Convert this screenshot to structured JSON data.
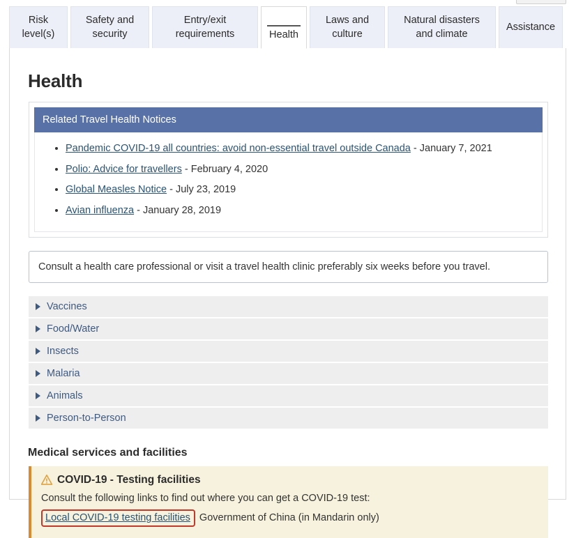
{
  "tabs": [
    {
      "label": "Risk level(s)",
      "active": false
    },
    {
      "label": "Safety and security",
      "active": false
    },
    {
      "label": "Entry/exit requirements",
      "active": false
    },
    {
      "label": "Health",
      "active": true
    },
    {
      "label": "Laws and culture",
      "active": false
    },
    {
      "label": "Natural disasters and climate",
      "active": false
    },
    {
      "label": "Assistance",
      "active": false
    }
  ],
  "page": {
    "title": "Health"
  },
  "notices": {
    "header": "Related Travel Health Notices",
    "items": [
      {
        "link": "Pandemic COVID-19 all countries: avoid non-essential travel outside Canada",
        "date": " - January 7, 2021"
      },
      {
        "link": "Polio: Advice for travellers",
        "date": " - February 4, 2020"
      },
      {
        "link": "Global Measles Notice",
        "date": " - July 23, 2019"
      },
      {
        "link": "Avian influenza",
        "date": " - January 28, 2019"
      }
    ]
  },
  "consult": {
    "text": "Consult a health care professional or visit a travel health clinic preferably six weeks before you travel."
  },
  "accordion": {
    "items": [
      {
        "label": "Vaccines"
      },
      {
        "label": "Food/Water"
      },
      {
        "label": "Insects"
      },
      {
        "label": "Malaria"
      },
      {
        "label": "Animals"
      },
      {
        "label": "Person-to-Person"
      }
    ]
  },
  "medical": {
    "section_title": "Medical services and facilities",
    "covid_heading": "COVID-19 - Testing facilities",
    "covid_intro": "Consult the following links to find out where you can get a COVID-19 test:",
    "covid_link": "Local COVID-19 testing facilities",
    "covid_link_suffix": "Government of China (in Mandarin only)"
  },
  "colors": {
    "notices_header_bg": "#5872a8",
    "accordion_text": "#3f5a80",
    "covid_bg": "#f6f2dd",
    "covid_border": "#d98b32",
    "highlight": "#c0392b",
    "link": "#295376"
  }
}
